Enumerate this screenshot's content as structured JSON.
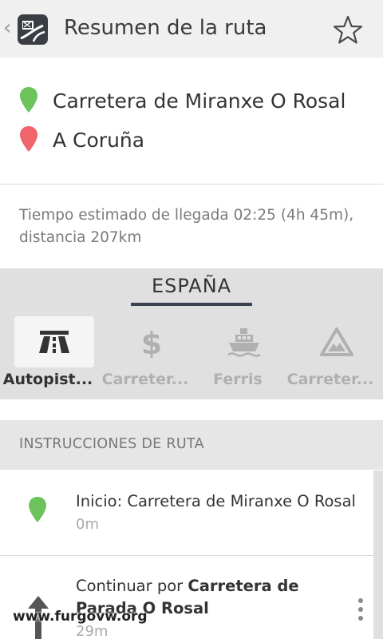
{
  "header": {
    "title": "Resumen de la ruta",
    "back_icon": "chevron-left-icon",
    "app_icon": "app-logo-icon",
    "favorite_icon": "star-outline-icon"
  },
  "route": {
    "origin": "Carretera de Miranxe  O Rosal",
    "destination": "A Coruña",
    "origin_color": "#6cc35c",
    "destination_color": "#f0646b"
  },
  "summary": {
    "eta_text": "Tiempo estimado de llegada 02:25 (4h 45m), distancia 207km"
  },
  "country": {
    "name": "ESPAÑA",
    "tabs": [
      {
        "label": "Autopist...",
        "icon": "highway-icon",
        "active": true
      },
      {
        "label": "Carreter...",
        "icon": "dollar-icon",
        "active": false
      },
      {
        "label": "Ferris",
        "icon": "ferry-icon",
        "active": false
      },
      {
        "label": "Carreter...",
        "icon": "mountain-road-icon",
        "active": false
      }
    ]
  },
  "instructions": {
    "header": "INSTRUCCIONES DE RUTA",
    "steps": [
      {
        "text": "Inicio: Carretera de Miranxe O Rosal",
        "distance": "0m",
        "icon": "green-pin-icon"
      },
      {
        "prefix": "Continuar por ",
        "road": "Carretera de Parada O Rosal",
        "distance": "29m",
        "icon": "arrow-up-icon"
      }
    ]
  },
  "watermark": "www.furgovw.org"
}
